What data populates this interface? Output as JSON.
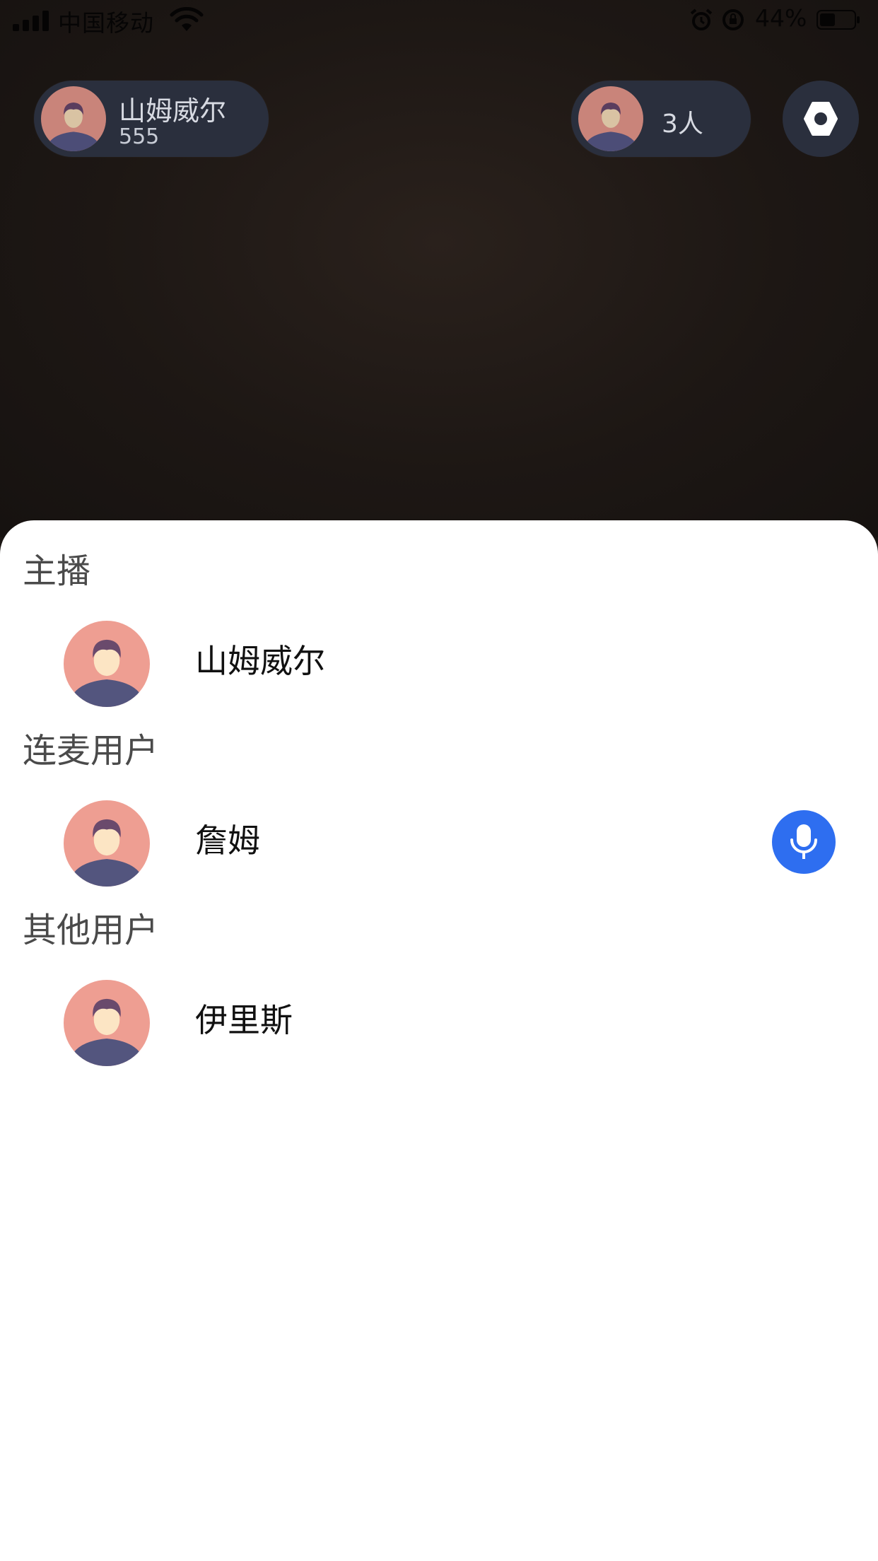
{
  "status_bar": {
    "carrier": "中国移动",
    "battery_percent": "44%",
    "icons": [
      "signal-icon",
      "wifi-icon",
      "alarm-icon",
      "orientation-lock-icon",
      "battery-icon"
    ]
  },
  "header": {
    "host": {
      "name": "山姆威尔",
      "count": "555"
    },
    "audience": {
      "count_label": "3人"
    },
    "settings_icon": "settings-hexagon-icon"
  },
  "sheet": {
    "sections": {
      "host": {
        "title": "主播",
        "users": [
          {
            "name": "山姆威尔"
          }
        ]
      },
      "co_hosts": {
        "title": "连麦用户",
        "users": [
          {
            "name": "詹姆",
            "action_icon": "microphone-icon"
          }
        ]
      },
      "others": {
        "title": "其他用户",
        "users": [
          {
            "name": "伊里斯"
          }
        ]
      }
    }
  },
  "colors": {
    "sheet_background": "#ffffff",
    "pill_background": "#2a2f3d",
    "mic_button": "#2e6ef0",
    "avatar_background": "#ee9e92"
  }
}
